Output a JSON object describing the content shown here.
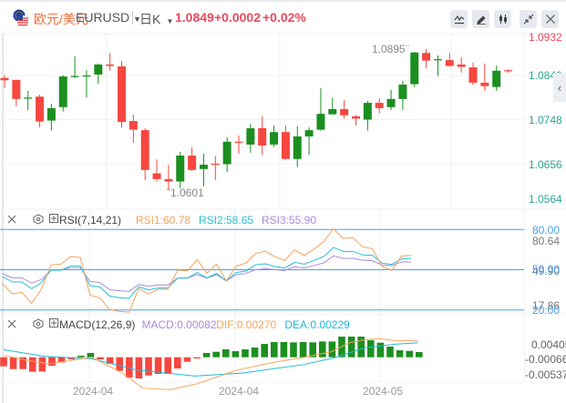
{
  "header": {
    "pair_cn": "欧元/美元",
    "symbol": "EURUSD",
    "period": "日K",
    "price": "1.0849",
    "change": "+0.0002",
    "change_pct": "+0.02%",
    "buttons": [
      {
        "icon": "indicator-icon"
      },
      {
        "icon": "draw-pen-icon"
      },
      {
        "icon": "candlestick-type-icon"
      },
      {
        "icon": "collapse-icon"
      },
      {
        "icon": "close-icon"
      }
    ]
  },
  "colors": {
    "up": "#1b8f1f",
    "down": "#f5473f",
    "accent": "#f26b3a",
    "price_red": "#e84a5f",
    "axis_green": "#2aa58f",
    "level": "#4a9ef0",
    "rsi1": "#f6a35a",
    "rsi2": "#22c1d6",
    "rsi3": "#a98be2",
    "dif": "#f6a35a",
    "dea": "#22b8d6"
  },
  "price_axis": {
    "labels": [
      "1.0932",
      "1.0840",
      "1.0748",
      "1.0656",
      "1.0564"
    ],
    "high_label": "1.0895",
    "low_label": "1.0601"
  },
  "candles": [
    [
      1.0835,
      1.0841,
      1.0814,
      1.083
    ],
    [
      1.0831,
      1.0831,
      1.0776,
      1.0791
    ],
    [
      1.0792,
      1.0808,
      1.0768,
      1.0794
    ],
    [
      1.0796,
      1.08,
      1.0732,
      1.0744
    ],
    [
      1.0746,
      1.0781,
      1.0725,
      1.0772
    ],
    [
      1.0774,
      1.0841,
      1.0765,
      1.0838
    ],
    [
      1.0838,
      1.088,
      1.0835,
      1.0839
    ],
    [
      1.0839,
      1.0851,
      1.0794,
      1.084
    ],
    [
      1.0842,
      1.0865,
      1.0823,
      1.0863
    ],
    [
      1.0863,
      1.0887,
      1.085,
      1.086
    ],
    [
      1.0859,
      1.087,
      1.0731,
      1.0743
    ],
    [
      1.0745,
      1.0758,
      1.07,
      1.0727
    ],
    [
      1.0726,
      1.073,
      1.0622,
      1.0643
    ],
    [
      1.0636,
      1.0665,
      1.0619,
      1.0624
    ],
    [
      1.0624,
      1.0654,
      1.0601,
      1.0619
    ],
    [
      1.0619,
      1.0681,
      1.0605,
      1.0673
    ],
    [
      1.0673,
      1.069,
      1.0641,
      1.0643
    ],
    [
      1.0645,
      1.0677,
      1.0609,
      1.0654
    ],
    [
      1.0656,
      1.0672,
      1.0622,
      1.0655
    ],
    [
      1.0655,
      1.0711,
      1.0638,
      1.0702
    ],
    [
      1.0702,
      1.0715,
      1.0677,
      1.07
    ],
    [
      1.0696,
      1.0739,
      1.0679,
      1.073
    ],
    [
      1.073,
      1.0755,
      1.0674,
      1.0694
    ],
    [
      1.0696,
      1.0736,
      1.0691,
      1.0722
    ],
    [
      1.0722,
      1.0736,
      1.0664,
      1.0666
    ],
    [
      1.0666,
      1.0734,
      1.0649,
      1.0713
    ],
    [
      1.0713,
      1.0732,
      1.0674,
      1.0726
    ],
    [
      1.0727,
      1.0814,
      1.0725,
      1.076
    ],
    [
      1.0759,
      1.0793,
      1.0759,
      1.077
    ],
    [
      1.077,
      1.0789,
      1.075,
      1.0757
    ],
    [
      1.0755,
      1.0758,
      1.0736,
      1.075
    ],
    [
      1.0748,
      1.0787,
      1.0725,
      1.0783
    ],
    [
      1.0783,
      1.0793,
      1.0761,
      1.0772
    ],
    [
      1.0774,
      1.081,
      1.0768,
      1.0791
    ],
    [
      1.0791,
      1.0829,
      1.0768,
      1.0821
    ],
    [
      1.0822,
      1.0889,
      1.0816,
      1.0888
    ],
    [
      1.0887,
      1.0895,
      1.0855,
      1.0871
    ],
    [
      1.0872,
      1.0882,
      1.0839,
      1.0874
    ],
    [
      1.0872,
      1.0887,
      1.0858,
      1.086
    ],
    [
      1.0863,
      1.0878,
      1.0846,
      1.0858
    ],
    [
      1.0857,
      1.0867,
      1.082,
      1.0825
    ],
    [
      1.0825,
      1.0865,
      1.0808,
      1.0818
    ],
    [
      1.0816,
      1.0861,
      1.0808,
      1.085
    ],
    [
      1.0851,
      1.0853,
      1.0846,
      1.0849
    ]
  ],
  "rsi": {
    "title": "RSI(7,14,21)",
    "rsi1_label": "RSI1:60.78",
    "rsi2_label": "RSI2:58.65",
    "rsi3_label": "RSI3:55.90",
    "axis": {
      "upper": "80.00",
      "max": "80.64",
      "mid": "50.00",
      "mid2": "49.90",
      "min": "17.86",
      "lower": "20.00"
    },
    "levels": [
      80,
      50,
      20
    ],
    "rsi1": [
      39.5,
      32.0,
      33.2,
      25.0,
      35.4,
      53.7,
      54.2,
      59.8,
      59.2,
      30.9,
      29.1,
      20.3,
      18.9,
      18.4,
      35.9,
      32.0,
      35.4,
      35.4,
      49.7,
      49.2,
      57.6,
      47.4,
      54.2,
      41.7,
      52.6,
      54.9,
      62.1,
      63.9,
      59.6,
      56.9,
      64.8,
      60.7,
      65.3,
      70.9,
      80.6,
      73.4,
      73.9,
      67.1,
      65.7,
      52.4,
      49.5,
      60.3,
      60.7
    ],
    "rsi2": [
      44.9,
      40.9,
      40.9,
      35.9,
      40.4,
      49.7,
      49.7,
      52.8,
      52.8,
      38.1,
      37.2,
      30.4,
      29.1,
      28.6,
      37.2,
      35.0,
      36.3,
      36.3,
      43.8,
      43.8,
      47.9,
      44.0,
      47.2,
      41.7,
      47.9,
      49.0,
      53.7,
      54.4,
      52.4,
      51.2,
      55.5,
      54.2,
      56.9,
      59.8,
      66.6,
      63.7,
      63.7,
      61.0,
      60.8,
      54.9,
      54.0,
      58.0,
      58.5
    ],
    "rsi3": [
      47.2,
      44.0,
      44.0,
      39.9,
      42.7,
      49.7,
      49.7,
      51.5,
      51.5,
      41.3,
      40.4,
      35.2,
      34.3,
      33.8,
      39.0,
      37.7,
      38.6,
      38.6,
      43.8,
      43.8,
      46.3,
      43.8,
      46.3,
      41.7,
      46.3,
      47.2,
      50.1,
      50.8,
      50.1,
      49.4,
      52.2,
      51.2,
      53.1,
      55.1,
      60.3,
      58.5,
      58.5,
      57.1,
      56.7,
      53.5,
      53.1,
      55.8,
      55.8
    ]
  },
  "macd": {
    "title": "MACD(12,26,9)",
    "macd_label": "MACD:0.00082",
    "dif_label": "DIF:0.00270",
    "dea_label": "DEA:0.00229",
    "axis": [
      "0.00405",
      "-0.00066",
      "-0.00537"
    ],
    "hist": [
      -0.00289,
      -0.00376,
      -0.00376,
      -0.00462,
      -0.00453,
      -0.0027,
      -0.00164,
      -0.00067,
      0.00048,
      0.00135,
      -0.00067,
      -0.00212,
      -0.00433,
      -0.00645,
      -0.00674,
      -0.00578,
      -0.0053,
      -0.0053,
      -0.00356,
      -0.00144,
      -0.00039,
      0.00135,
      0.00173,
      0.0025,
      0.00193,
      0.0025,
      0.00308,
      0.00424,
      0.00482,
      0.00482,
      0.00472,
      0.00482,
      0.00472,
      0.005,
      0.005,
      0.00655,
      0.00655,
      0.00655,
      0.00539,
      0.00462,
      0.00337,
      0.00221,
      0.00202,
      0.00164
    ],
    "dif": [
      [
        0,
        0.00058
      ],
      [
        2.8,
        -0.00116
      ],
      [
        4.7,
        -0.00212
      ],
      [
        9.1,
        0
      ],
      [
        12.2,
        -0.00482
      ],
      [
        14.4,
        -0.00982
      ],
      [
        17.2,
        -0.0103
      ],
      [
        20.1,
        -0.00838
      ],
      [
        24.2,
        -0.00404
      ],
      [
        27.9,
        -0.00164
      ],
      [
        31.1,
        0
      ],
      [
        33.9,
        0.00173
      ],
      [
        35.8,
        0.00462
      ],
      [
        37.4,
        0.00559
      ],
      [
        38.9,
        0.00587
      ],
      [
        40.5,
        0.0053
      ],
      [
        42.9,
        0.0053
      ]
    ],
    "dea": [
      [
        0,
        0.00241
      ],
      [
        4.3,
        0.00029
      ],
      [
        9.1,
        -0.00048
      ],
      [
        13.8,
        -0.00404
      ],
      [
        19.8,
        -0.00597
      ],
      [
        24.8,
        -0.005
      ],
      [
        31.1,
        -0.00231
      ],
      [
        34.2,
        -0.00019
      ],
      [
        37.4,
        0.00299
      ],
      [
        40.5,
        0.00414
      ],
      [
        42.9,
        0.00462
      ]
    ]
  },
  "dates": [
    "2024-04",
    "2024-04",
    "2024-05"
  ]
}
